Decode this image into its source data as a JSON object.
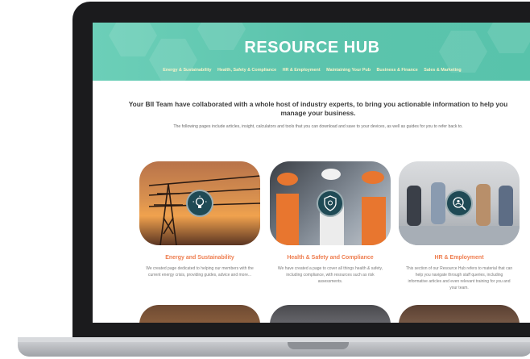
{
  "banner": {
    "title": "RESOURCE HUB",
    "nav": [
      "Energy & Sustainability",
      "Health, Safety & Compliance",
      "HR & Employment",
      "Maintaining Your Pub",
      "Business & Finance",
      "Sales & Marketing"
    ]
  },
  "intro": {
    "title": "Your BII Team have collaborated with a whole host of industry experts, to bring you actionable information to help you manage your business.",
    "text": "The following pages include articles, insight, calculators and tools that you can download and save to your devices, as well as guides for you to refer back to."
  },
  "cards": [
    {
      "title": "Energy and Sustainability",
      "text": "We created page dedicated to helping our members with the current energy crisis, providing guides, advice and more...",
      "icon": "lightbulb-icon"
    },
    {
      "title": "Health & Safety and Compliance",
      "text": "We have created a page to cover all things health & safety, including compliance, with resources such as risk assessments.",
      "icon": "shield-icon"
    },
    {
      "title": "HR & Employment",
      "text": "This section of our Resource Hub refers to material that can help you navigate through staff queries, including informative articles and even relevant training for you and your team.",
      "icon": "people-search-icon"
    }
  ],
  "colors": {
    "banner": "#5cc4ad",
    "accent": "#ee7d4f",
    "badge": "#1f4a55"
  }
}
